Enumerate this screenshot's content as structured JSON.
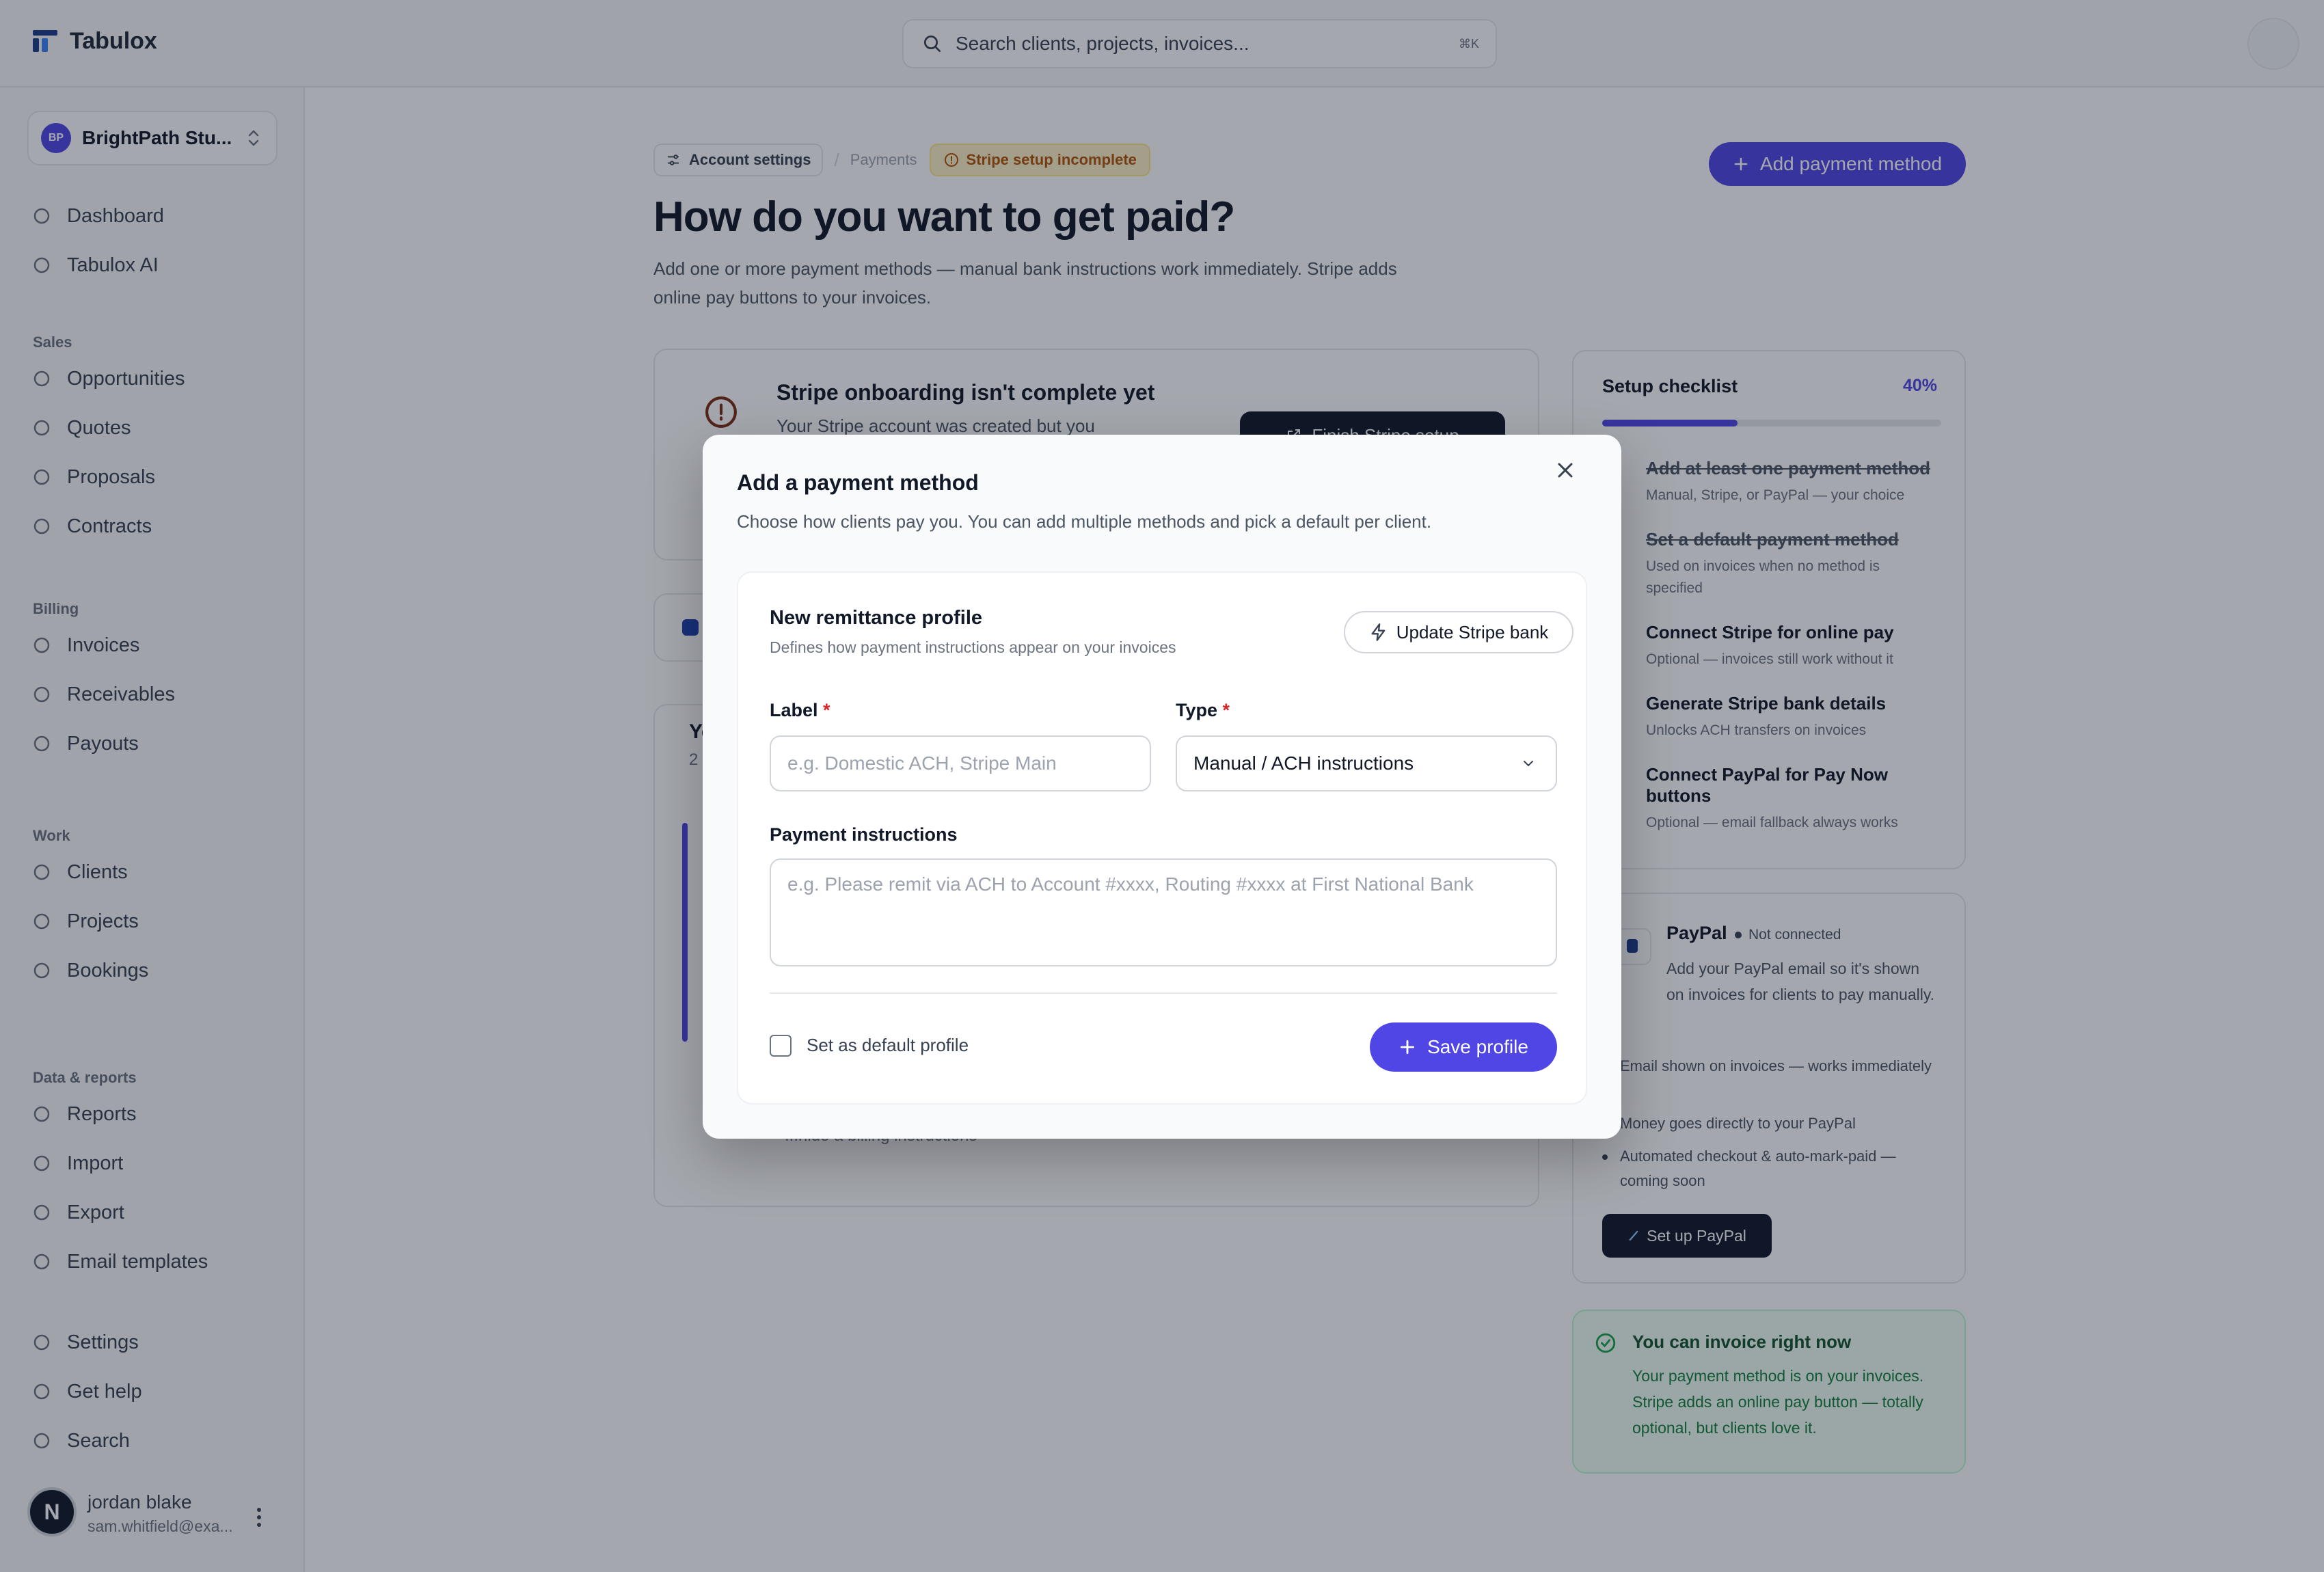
{
  "app": {
    "name": "Tabulox"
  },
  "search": {
    "placeholder": "Search clients, projects, invoices...",
    "shortcut": "⌘K"
  },
  "workspace": {
    "initials": "BP",
    "name": "BrightPath Stu..."
  },
  "sidebar": {
    "top": [
      {
        "label": "Dashboard",
        "icon": "dashboard-icon"
      },
      {
        "label": "Tabulox AI",
        "icon": "sparkle-icon"
      }
    ],
    "sections": [
      {
        "title": "Sales",
        "items": [
          "Opportunities",
          "Quotes",
          "Proposals",
          "Contracts"
        ]
      },
      {
        "title": "Billing",
        "items": [
          "Invoices",
          "Receivables",
          "Payouts"
        ]
      },
      {
        "title": "Work",
        "items": [
          "Clients",
          "Projects",
          "Bookings"
        ]
      },
      {
        "title": "Data & reports",
        "items": [
          "Reports",
          "Import",
          "Export",
          "Email templates"
        ]
      }
    ],
    "bottom": [
      "Settings",
      "Get help",
      "Search"
    ]
  },
  "user": {
    "avatar": "N",
    "name": "jordan blake",
    "email": "sam.whitfield@exa..."
  },
  "breadcrumb": {
    "settings": "Account settings",
    "payments": "Payments",
    "badge": "Stripe setup incomplete"
  },
  "page": {
    "title": "How do you want to get paid?",
    "subtitle_1": "Add one or more payment methods — manual bank instructions work immediately. Stripe adds",
    "subtitle_2": "online pay buttons to your invoices.",
    "add_button": "Add payment method"
  },
  "stripe_card": {
    "title": "Stripe onboarding isn't complete yet",
    "desc": "Your Stripe account was created but you",
    "button": "Finish Stripe setup"
  },
  "behind": {
    "frag1": "Yo",
    "frag2": "2",
    "frag3": "...hide a billing instructions"
  },
  "checklist": {
    "title": "Setup checklist",
    "percent": "40%",
    "progress": 0.4,
    "items": [
      {
        "title": "Add at least one payment method",
        "sub": "Manual, Stripe, or PayPal — your choice",
        "done": true
      },
      {
        "title": "Set a default payment method",
        "sub": "Used on invoices when no method is specified",
        "done": true
      },
      {
        "title": "Connect Stripe for online pay",
        "sub": "Optional — invoices still work without it",
        "done": false
      },
      {
        "title": "Generate Stripe bank details",
        "sub": "Unlocks ACH transfers on invoices",
        "done": false
      },
      {
        "title": "Connect PayPal for Pay Now buttons",
        "sub": "Optional — email fallback always works",
        "done": false
      }
    ]
  },
  "paypal": {
    "name": "PayPal",
    "status": "Not connected",
    "desc": "Add your PayPal email so it's shown on invoices for clients to pay manually.",
    "bullets": [
      "Email shown on invoices — works immediately",
      "Money goes directly to your PayPal",
      "Automated checkout & auto-mark-paid — coming soon"
    ],
    "button": "Set up PayPal"
  },
  "ready": {
    "title": "You can invoice right now",
    "desc": "Your payment method is on your invoices. Stripe adds an online pay button — totally optional, but clients love it."
  },
  "modal": {
    "title": "Add a payment method",
    "subtitle": "Choose how clients pay you. You can add multiple methods and pick a default per client.",
    "section_title": "New remittance profile",
    "section_sub": "Defines how payment instructions appear on your invoices",
    "update_button": "Update Stripe bank",
    "label_label": "Label",
    "label_placeholder": "e.g. Domestic ACH, Stripe Main",
    "type_label": "Type",
    "type_value": "Manual / ACH instructions",
    "instructions_label": "Payment instructions",
    "instructions_placeholder": "e.g. Please remit via ACH to Account #xxxx, Routing #xxxx at First National Bank",
    "default_checkbox": "Set as default profile",
    "default_checked": false,
    "save_button": "Save profile",
    "required_mark": "*"
  },
  "colors": {
    "accent": "#4f46e5",
    "dark": "#111827",
    "warning": "#b45309",
    "success": "#15803d"
  }
}
